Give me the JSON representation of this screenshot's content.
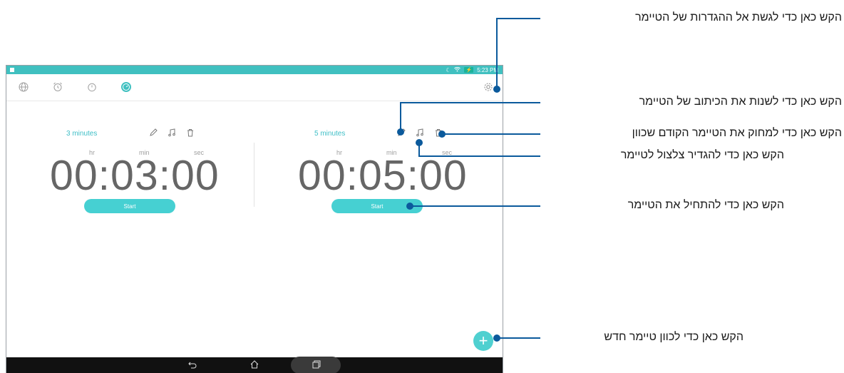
{
  "status_bar": {
    "time": "5:23 PM",
    "battery_icon": "battery-charging-icon",
    "wifi_icon": "wifi-icon",
    "moon_icon": "moon-icon"
  },
  "toolbar": {
    "tabs": [
      "globe-icon",
      "alarm-icon",
      "stopwatch-icon",
      "timer-icon"
    ],
    "settings_icon": "gear-icon"
  },
  "timers": [
    {
      "name": "3 minutes",
      "units": {
        "hr": "hr",
        "min": "min",
        "sec": "sec"
      },
      "time": "00:03:00",
      "start_label": "Start"
    },
    {
      "name": "5 minutes",
      "units": {
        "hr": "hr",
        "min": "min",
        "sec": "sec"
      },
      "time": "00:05:00",
      "start_label": "Start"
    }
  ],
  "timer_icons": [
    "pencil-icon",
    "music-note-icon",
    "trash-icon"
  ],
  "fab": {
    "label": "+"
  },
  "nav": {
    "back": "back-icon",
    "home": "home-icon",
    "recents": "recents-icon"
  },
  "callouts": {
    "settings": "הקש כאן כדי לגשת אל ההגדרות של הטיימר",
    "rename": "הקש כאן כדי לשנות את הכיתוב של הטיימר",
    "delete": "הקש כאן כדי למחוק את הטיימר הקודם שכוון",
    "sound": "הקש כאן כדי להגדיר צלצול לטיימר",
    "start": "הקש כאן כדי להתחיל את הטיימר",
    "new_timer": "הקש כאן כדי לכוון טיימר חדש"
  },
  "colors": {
    "accent": "#40c0c0",
    "callout_line": "#0b5a9c"
  }
}
